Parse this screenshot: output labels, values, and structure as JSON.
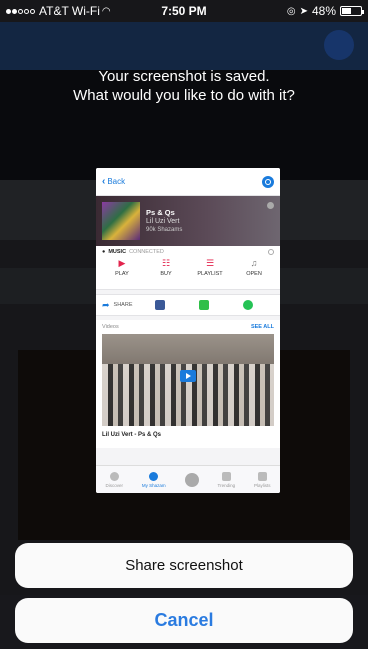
{
  "status_bar": {
    "carrier": "AT&T Wi-Fi",
    "time": "7:50 PM",
    "battery": "48%",
    "battery_level": 0.48
  },
  "prompt": {
    "line1": "Your screenshot is saved.",
    "line2": "What would you like to do with it?"
  },
  "thumbnail": {
    "back_label": "Back",
    "song": {
      "title": "Ps & Qs",
      "artist": "Lil Uzi Vert",
      "shazams": "90k Shazams"
    },
    "music_header": "MUSIC",
    "music_status": "CONNECTED",
    "actions": [
      {
        "label": "PLAY",
        "icon": "play-icon"
      },
      {
        "label": "BUY",
        "icon": "cart-icon"
      },
      {
        "label": "PLAYLIST",
        "icon": "playlist-icon"
      },
      {
        "label": "OPEN",
        "icon": "music-note-icon"
      }
    ],
    "share_label": "SHARE",
    "videos_label": "Videos",
    "see_all": "SEE ALL",
    "video_title": "Lil Uzi Vert - Ps & Qs",
    "tabs": [
      {
        "label": "Discover",
        "active": false
      },
      {
        "label": "My Shazam",
        "active": true
      },
      {
        "label": "",
        "active": false
      },
      {
        "label": "Trending",
        "active": false
      },
      {
        "label": "Playlists",
        "active": false
      }
    ]
  },
  "sheet": {
    "share_label": "Share screenshot",
    "cancel_label": "Cancel"
  },
  "colors": {
    "accent": "#2a7be0",
    "shazam_blue": "#1a7bdc",
    "apple_music_red": "#e2244d"
  }
}
